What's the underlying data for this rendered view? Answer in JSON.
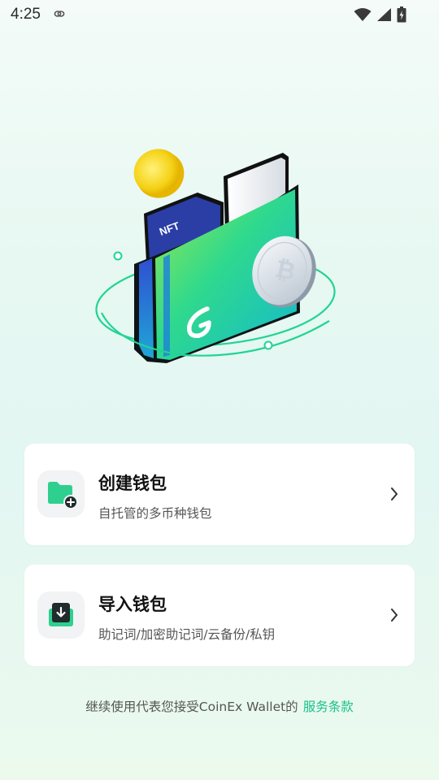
{
  "status_bar": {
    "time": "4:25",
    "icons": [
      "sync-icon",
      "wifi-icon",
      "cell-signal-icon",
      "battery-icon"
    ]
  },
  "illustration": {
    "nft_label": "NFT",
    "icons": [
      "wallet-icon",
      "bitcoin-coin-icon",
      "gold-coin-icon",
      "orbit-ring"
    ]
  },
  "actions": {
    "create": {
      "title": "创建钱包",
      "subtitle": "自托管的多币种钱包",
      "icon": "folder-add-icon"
    },
    "import": {
      "title": "导入钱包",
      "subtitle": "助记词/加密助记词/云备份/私钥",
      "icon": "download-icon"
    }
  },
  "footer": {
    "text": "继续使用代表您接受CoinEx Wallet的",
    "link": "服务条款"
  },
  "colors": {
    "accent": "#18c08a",
    "icon_green": "#2fcf8f",
    "dark": "#1f2b2c"
  }
}
